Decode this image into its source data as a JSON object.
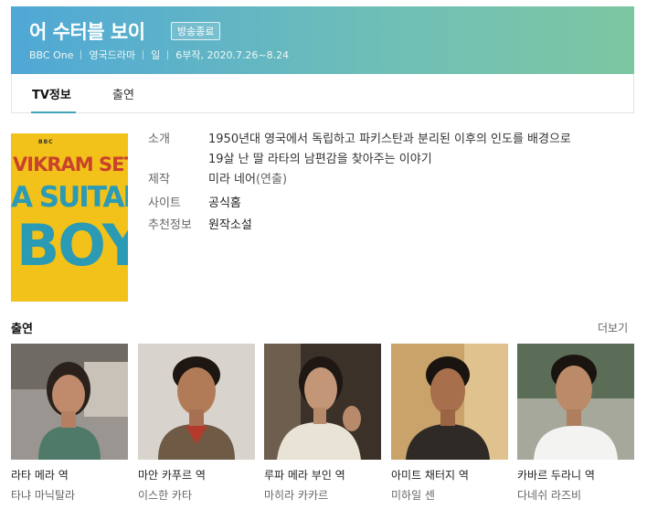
{
  "header": {
    "title": "어 수터블 보이",
    "badge": "방송종료",
    "meta": [
      "BBC One",
      "영국드라마",
      "일",
      "6부작, 2020.7.26~8.24"
    ]
  },
  "tabs": [
    "TV정보",
    "출연"
  ],
  "poster": {
    "bbc": "BBC",
    "line1": "VIKRAM SETH",
    "line2": "A SUITABLE",
    "line3": "BOY"
  },
  "info": {
    "summary_label": "소개",
    "summary_line1": "1950년대 영국에서 독립하고 파키스탄과 분리된 이후의 인도를 배경으로",
    "summary_line2": "19살 난 딸 라타의 남편감을 찾아주는 이야기",
    "production_label": "제작",
    "production_name": "미라 네어",
    "production_role": "(연출)",
    "site_label": "사이트",
    "site_value": "공식홈",
    "recommend_label": "추천정보",
    "recommend_value": "원작소설"
  },
  "cast_section": {
    "title": "출연",
    "more": "더보기",
    "members": [
      {
        "role": "라타 메라 역",
        "actor": "타냐 마닉탈라"
      },
      {
        "role": "마안 카푸르 역",
        "actor": "이스한 카타"
      },
      {
        "role": "루파 메라 부인 역",
        "actor": "마히라 카카르"
      },
      {
        "role": "아미트 채터지 역",
        "actor": "미하일 센"
      },
      {
        "role": "카바르 두라니 역",
        "actor": "다네쉬 라즈비"
      }
    ]
  },
  "colors": {
    "accent": "#3fa4b8",
    "header_start": "#4fa8d6",
    "header_end": "#7dc6a2",
    "poster_bg": "#f2c21a"
  }
}
